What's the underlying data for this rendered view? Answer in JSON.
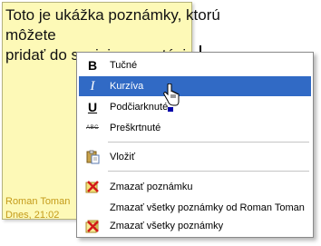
{
  "note": {
    "text": "Toto je ukážka poznámky, ktorú môžete\npridať do svojej prezentácie.",
    "author": "Roman Toman",
    "date": "Dnes, 21:02",
    "background": "#fdf9b7",
    "meta_color": "#c49b1a"
  },
  "menu": {
    "highlight_color": "#316ac5",
    "items": [
      {
        "label": "Tučné",
        "icon": "bold-icon"
      },
      {
        "label": "Kurzíva",
        "icon": "italic-icon"
      },
      {
        "label": "Podčiarknuté",
        "icon": "underline-icon"
      },
      {
        "label": "Preškrtnuté",
        "icon": "strikethrough-icon",
        "icon_text": "ABC"
      },
      {
        "label": "Vložiť",
        "icon": "paste-icon"
      },
      {
        "label": "Zmazať poznámku",
        "icon": "delete-note-icon"
      },
      {
        "label": "Zmazať všetky poznámky od Roman Toman",
        "icon": ""
      },
      {
        "label": "Zmazať všetky poznámky",
        "icon": "delete-all-notes-icon"
      }
    ]
  }
}
